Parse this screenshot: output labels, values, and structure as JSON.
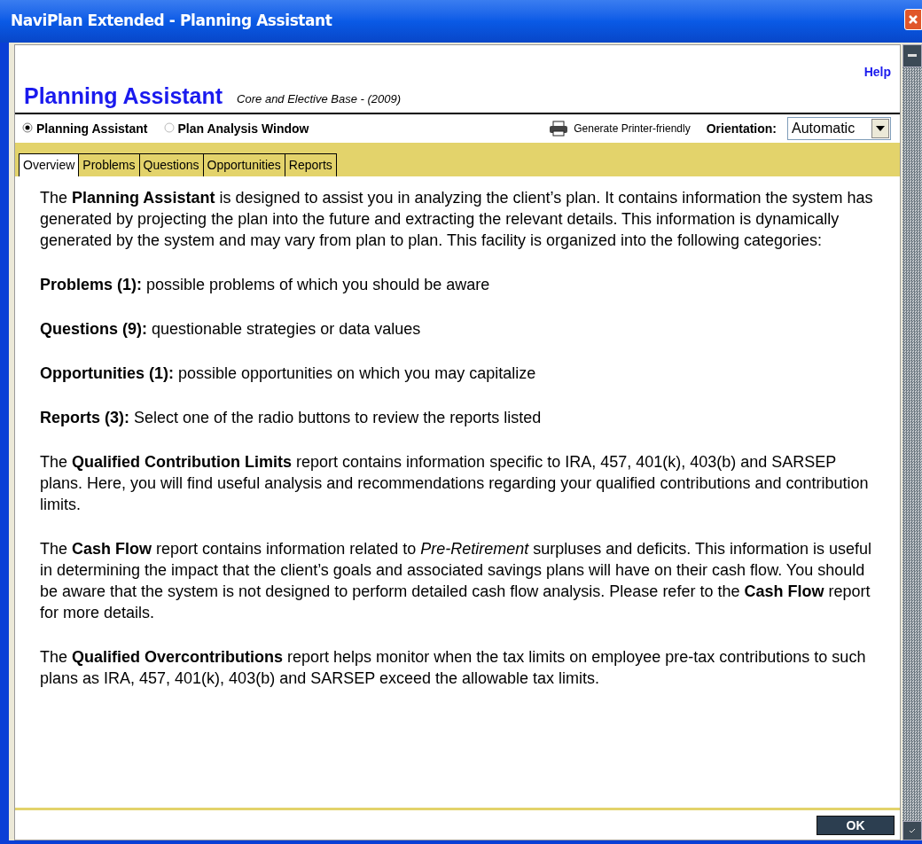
{
  "window": {
    "title": "NaviPlan Extended - Planning Assistant"
  },
  "help_link": "Help",
  "heading": {
    "title": "Planning Assistant",
    "subtitle": "Core and Elective Base - (2009)"
  },
  "views": [
    {
      "label": "Planning Assistant",
      "selected": true
    },
    {
      "label": "Plan Analysis Window",
      "selected": false
    }
  ],
  "printer_link": "Generate Printer-friendly",
  "orientation": {
    "label": "Orientation:",
    "value": "Automatic"
  },
  "tabs": [
    {
      "label": "Overview",
      "selected": true
    },
    {
      "label": "Problems",
      "selected": false
    },
    {
      "label": "Questions",
      "selected": false
    },
    {
      "label": "Opportunities",
      "selected": false
    },
    {
      "label": "Reports",
      "selected": false
    }
  ],
  "intro": "The **Planning Assistant** is designed to assist you in analyzing the client’s plan. It contains information the system has generated by projecting the plan into the future and extracting the relevant details. This information is dynamically generated by the system and may vary from plan to plan. This facility is organized into the following categories:",
  "categories": [
    "**Problems (1):** possible problems of which you should be aware",
    "**Questions (9):** questionable strategies or data values",
    "**Opportunities (1):** possible opportunities on which you may capitalize",
    "**Reports (3):** Select one of the radio buttons to review the reports listed"
  ],
  "report_descriptions": [
    "The **Qualified Contribution Limits** report contains information specific to IRA, 457, 401(k), 403(b) and SARSEP plans. Here, you will find useful analysis and recommendations regarding your qualified contributions and contribution limits.",
    "The **Cash Flow** report contains information related to *Pre-Retirement* surpluses and deficits. This information is useful in determining the impact that the client’s goals and associated savings plans will have on their cash flow. You should be aware that the system is not designed to perform detailed cash flow analysis. Please refer to the **Cash Flow** report for more details.",
    "The **Qualified Overcontributions** report helps monitor when the tax limits on employee pre-tax contributions to such plans as IRA, 457, 401(k), 403(b) and SARSEP exceed the allowable tax limits."
  ],
  "ok_button": "OK"
}
